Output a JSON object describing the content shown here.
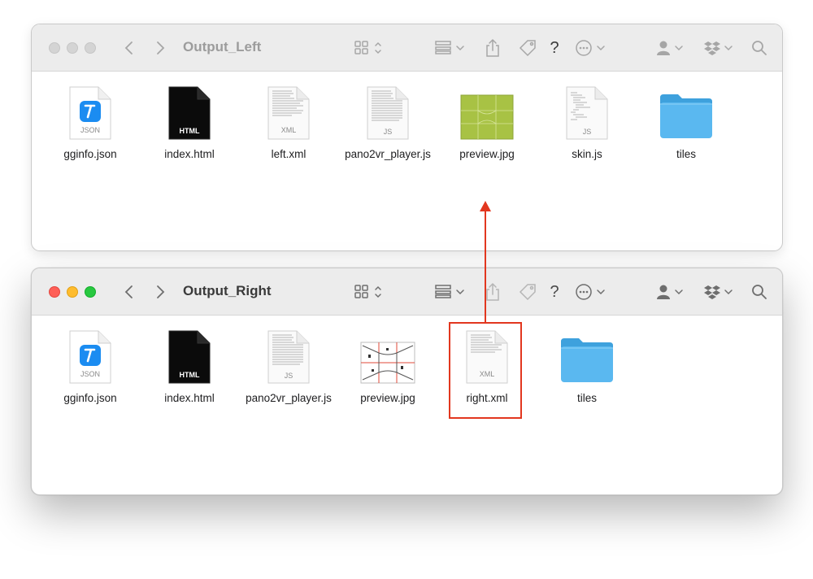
{
  "windows": [
    {
      "title": "Output_Left",
      "files": [
        {
          "name": "gginfo.json",
          "kind": "json",
          "tag": "JSON"
        },
        {
          "name": "index.html",
          "kind": "html",
          "tag": "HTML"
        },
        {
          "name": "left.xml",
          "kind": "doc",
          "tag": "XML"
        },
        {
          "name": "pano2vr_player.js",
          "kind": "doc",
          "tag": "JS"
        },
        {
          "name": "preview.jpg",
          "kind": "green-preview",
          "tag": ""
        },
        {
          "name": "skin.js",
          "kind": "code",
          "tag": "JS"
        },
        {
          "name": "tiles",
          "kind": "folder",
          "tag": ""
        }
      ]
    },
    {
      "title": "Output_Right",
      "files": [
        {
          "name": "gginfo.json",
          "kind": "json",
          "tag": "JSON"
        },
        {
          "name": "index.html",
          "kind": "html",
          "tag": "HTML"
        },
        {
          "name": "pano2vr_player.js",
          "kind": "doc",
          "tag": "JS"
        },
        {
          "name": "preview.jpg",
          "kind": "cube-preview",
          "tag": ""
        },
        {
          "name": "right.xml",
          "kind": "doc",
          "tag": "XML"
        },
        {
          "name": "tiles",
          "kind": "folder",
          "tag": ""
        }
      ]
    }
  ],
  "toolbar_icons": [
    "back-icon",
    "forward-icon",
    "view-grid-icon",
    "group-icon",
    "share-icon",
    "tag-icon",
    "help-icon",
    "more-icon",
    "user-icon",
    "dropbox-icon",
    "search-icon"
  ],
  "toolbar_help_glyph": "?",
  "colors": {
    "highlight": "#e2371f",
    "folder": "#5ab8f0",
    "json_badge": "#1b8cf1"
  }
}
